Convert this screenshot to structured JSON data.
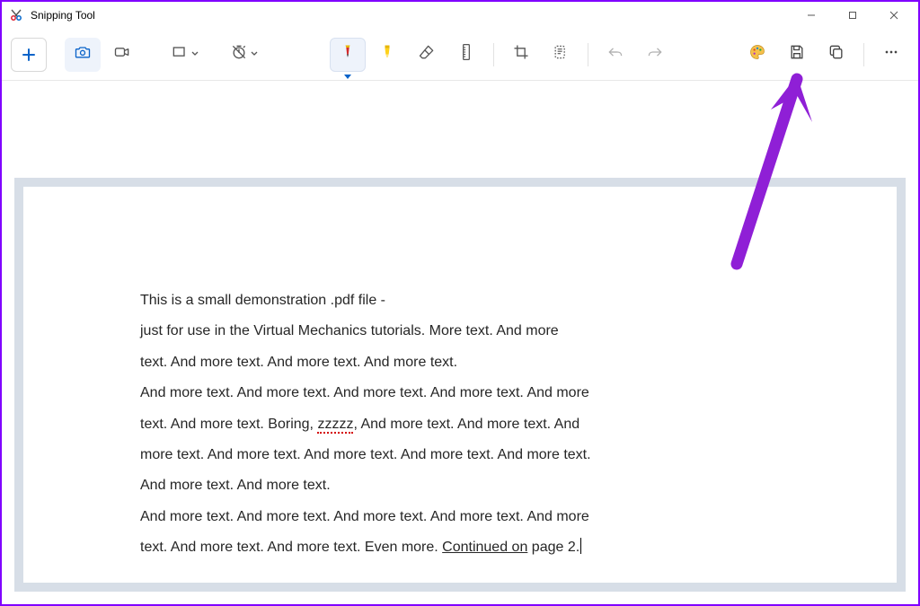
{
  "window": {
    "title": "Snipping Tool"
  },
  "document": {
    "lines": [
      "This is a small demonstration .pdf file -",
      "just for use in the Virtual Mechanics tutorials. More text. And more",
      "text. And more text. And more text. And more text.",
      "And more text. And more text. And more text. And more text. And more",
      "text. And more text. Boring, ",
      ", And more text. And more text. And",
      "more text. And more text. And more text. And more text. And more text.",
      "And more text. And more text.",
      "And more text. And more text. And more text. And more text. And more",
      "text. And more text. And more text. Even more. "
    ],
    "zzzzz": "zzzzz",
    "continued": "Continued on",
    "continued_tail": " page 2."
  },
  "toolbar": {
    "new_snip": "New",
    "camera": "Screenshot mode",
    "video": "Record mode",
    "snip_mode": "Snip shape",
    "delay": "Delay",
    "pen": "Ballpoint pen",
    "highlighter": "Highlighter",
    "eraser": "Eraser",
    "ruler": "Ruler",
    "crop": "Crop",
    "text_actions": "Text actions",
    "undo": "Undo",
    "redo": "Redo",
    "paint": "Edit in Paint",
    "save": "Save",
    "copy": "Copy",
    "more": "See more"
  }
}
